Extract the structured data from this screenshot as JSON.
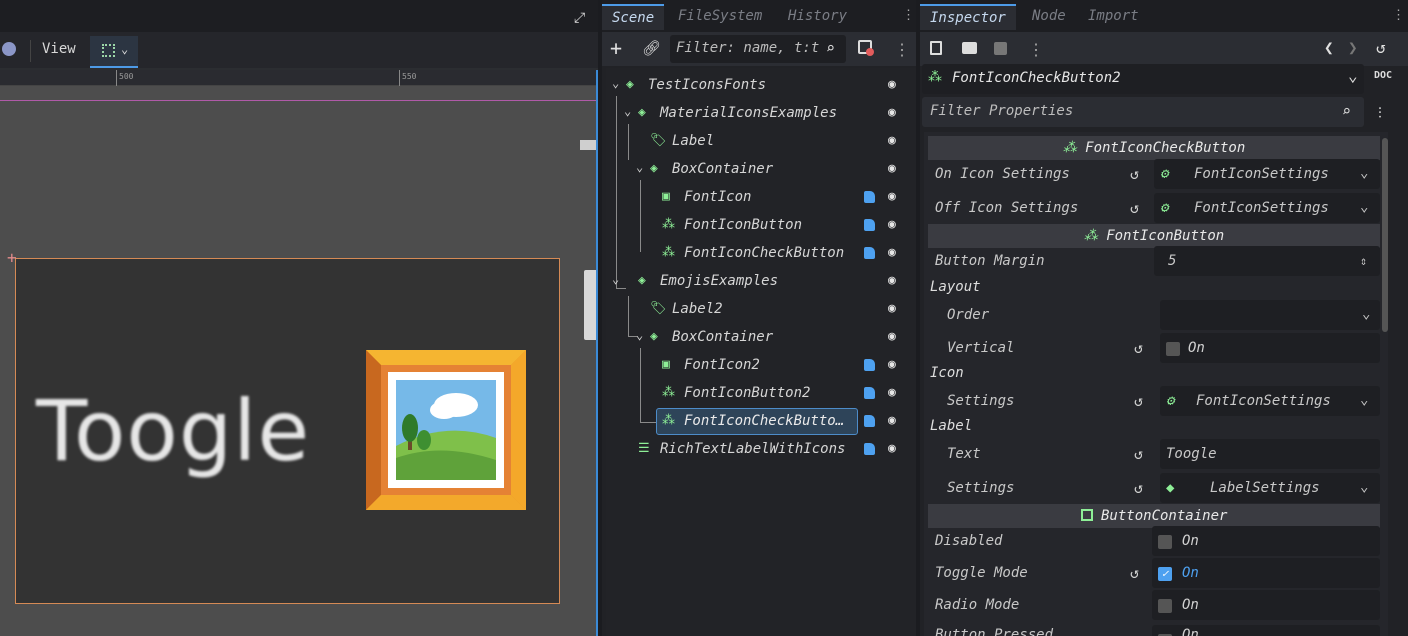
{
  "viewport": {
    "view_label": "View",
    "ruler_marks": [
      "500",
      "550"
    ],
    "canvas_text": "Toogle"
  },
  "scene_panel": {
    "tabs": [
      "Scene",
      "FileSystem",
      "History"
    ],
    "filter_placeholder": "Filter: name, t:t",
    "tree": [
      {
        "label": "TestIconsFonts",
        "icon": "control-node-icon",
        "script": false
      },
      {
        "label": "MaterialIconsExamples",
        "icon": "control-node-icon",
        "script": false
      },
      {
        "label": "Label",
        "icon": "label-node-icon",
        "script": false
      },
      {
        "label": "BoxContainer",
        "icon": "control-node-icon",
        "script": false
      },
      {
        "label": "FontIcon",
        "icon": "texture-rect-icon",
        "script": true
      },
      {
        "label": "FontIconButton",
        "icon": "button-cursor-icon",
        "script": true
      },
      {
        "label": "FontIconCheckButton",
        "icon": "button-cursor-icon",
        "script": true
      },
      {
        "label": "EmojisExamples",
        "icon": "control-node-icon",
        "script": false
      },
      {
        "label": "Label2",
        "icon": "label-node-icon",
        "script": false
      },
      {
        "label": "BoxContainer",
        "icon": "control-node-icon",
        "script": false
      },
      {
        "label": "FontIcon2",
        "icon": "texture-rect-icon",
        "script": true
      },
      {
        "label": "FontIconButton2",
        "icon": "button-cursor-icon",
        "script": true
      },
      {
        "label": "FontIconCheckButto…",
        "icon": "button-cursor-icon",
        "script": true
      },
      {
        "label": "RichTextLabelWithIcons",
        "icon": "rich-text-icon",
        "script": true
      }
    ]
  },
  "inspector": {
    "tabs": [
      "Inspector",
      "Node",
      "Import"
    ],
    "node_name": "FontIconCheckButton2",
    "filter_placeholder": "Filter Properties",
    "sections": {
      "s1": "FontIconCheckButton",
      "s2": "FontIconButton",
      "s3": "ButtonContainer"
    },
    "groups": {
      "layout": "Layout",
      "icon": "Icon",
      "label": "Label"
    },
    "props": {
      "on_icon": {
        "label": "On Icon Settings",
        "value": "FontIconSettings"
      },
      "off_icon": {
        "label": "Off Icon Settings",
        "value": "FontIconSettings"
      },
      "button_margin": {
        "label": "Button Margin",
        "value": "5"
      },
      "order": {
        "label": "Order",
        "value": ""
      },
      "vertical": {
        "label": "Vertical",
        "value": "On"
      },
      "icon_settings": {
        "label": "Settings",
        "value": "FontIconSettings"
      },
      "text": {
        "label": "Text",
        "value": "Toogle"
      },
      "label_settings": {
        "label": "Settings",
        "value": "LabelSettings"
      },
      "disabled": {
        "label": "Disabled",
        "value": "On"
      },
      "toggle_mode": {
        "label": "Toggle Mode",
        "value": "On"
      },
      "radio_mode": {
        "label": "Radio Mode",
        "value": "On"
      },
      "button_pressed": {
        "label": "Button Pressed",
        "value": "On"
      }
    }
  },
  "colors": {
    "accent": "#4d9be8",
    "node_green": "#8eef97",
    "script_blue": "#4ea1f0"
  }
}
